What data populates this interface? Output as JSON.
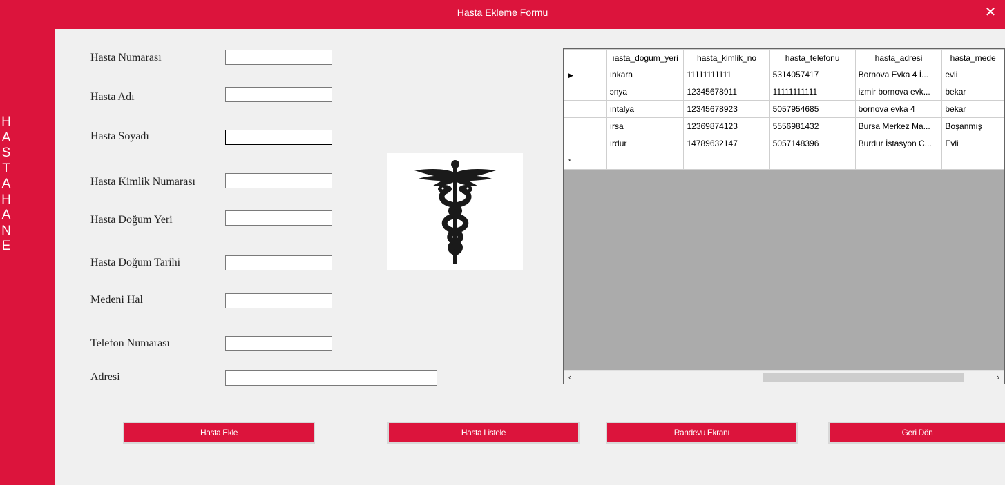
{
  "window": {
    "title": "Hasta Ekleme Formu",
    "close_glyph": "✕"
  },
  "side_letters": [
    "H",
    "A",
    "S",
    "T",
    "A",
    "H",
    "A",
    "N",
    "E"
  ],
  "form": {
    "labels": {
      "hasta_numarasi": "Hasta Numarası",
      "hasta_adi": "Hasta Adı",
      "hasta_soyadi": "Hasta Soyadı",
      "hasta_kimlik": "Hasta Kimlik Numarası",
      "hasta_dogum_yeri": "Hasta Doğum Yeri",
      "hasta_dogum_tarihi": "Hasta Doğum Tarihi",
      "medeni_hal": "Medeni Hal",
      "telefon": "Telefon Numarası",
      "adres": "Adresi"
    },
    "values": {
      "hasta_numarasi": "",
      "hasta_adi": "",
      "hasta_soyadi": "",
      "hasta_kimlik": "",
      "hasta_dogum_yeri": "",
      "hasta_dogum_tarihi": "",
      "medeni_hal": "",
      "telefon": "",
      "adres": ""
    }
  },
  "logo": {
    "icon": "caduceus-icon",
    "color": "#1a1a1a"
  },
  "grid": {
    "columns": [
      "ıasta_dogum_yeri",
      "hasta_kimlik_no",
      "hasta_telefonu",
      "hasta_adresi",
      "hasta_mede"
    ],
    "rows": [
      {
        "marker": "▶",
        "cells": [
          "ınkara",
          "11111111111",
          "5314057417",
          "Bornova Evka 4 İ...",
          "evli"
        ]
      },
      {
        "marker": "",
        "cells": [
          "ɔnya",
          "12345678911",
          "11111111111",
          "izmir bornova evk...",
          "bekar"
        ]
      },
      {
        "marker": "",
        "cells": [
          "ıntalya",
          "12345678923",
          "5057954685",
          "bornova evka 4",
          "bekar"
        ]
      },
      {
        "marker": "",
        "cells": [
          "ırsa",
          "12369874123",
          "5556981432",
          "Bursa Merkez Ma...",
          "Boşanmış"
        ]
      },
      {
        "marker": "",
        "cells": [
          "ırdur",
          "14789632147",
          "5057148396",
          "Burdur İstasyon C...",
          "Evli"
        ]
      },
      {
        "marker": "*",
        "cells": [
          "",
          "",
          "",
          "",
          ""
        ]
      }
    ],
    "scroll_left": "‹",
    "scroll_right": "›"
  },
  "buttons": {
    "ekle": "Hasta Ekle",
    "listele": "Hasta Listele",
    "randevu": "Randevu Ekranı",
    "geri": "Geri Dön"
  },
  "colors": {
    "accent": "#dc143c",
    "background": "#f0f0f0",
    "grid_empty": "#ababab"
  }
}
